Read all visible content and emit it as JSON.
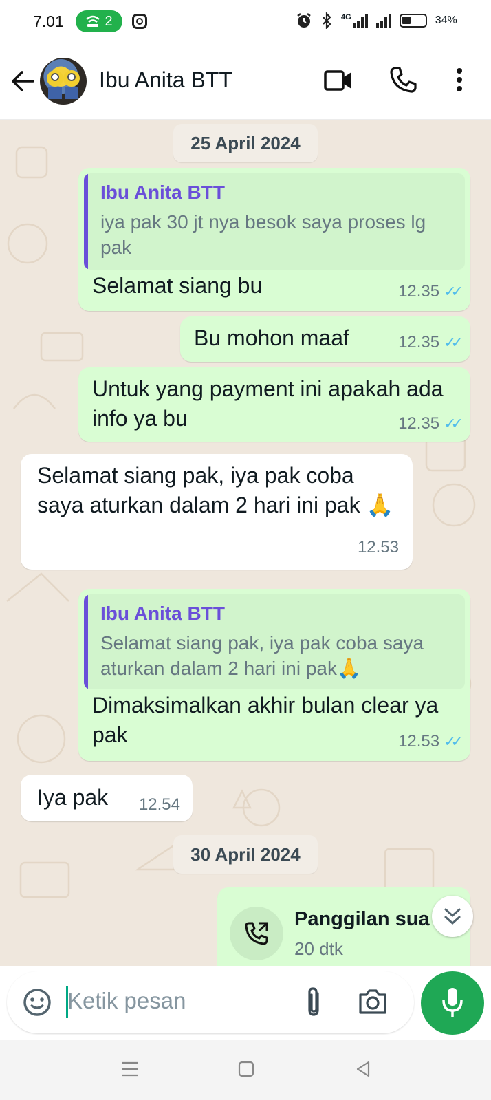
{
  "status_bar": {
    "time": "7.01",
    "hotspot_count": "2",
    "battery": "34%",
    "network": "4G"
  },
  "header": {
    "contact_name": "Ibu Anita BTT",
    "icons": [
      "back-arrow-icon",
      "video-call-icon",
      "voice-call-icon",
      "more-options-icon"
    ]
  },
  "chat": {
    "date_1": "25 April 2024",
    "date_2": "30 April 2024",
    "messages": [
      {
        "direction": "out",
        "quoted_name": "Ibu Anita BTT",
        "quoted_text": "iya pak 30 jt nya besok saya proses lg pak",
        "text": "Selamat siang bu",
        "time": "12.35"
      },
      {
        "direction": "out",
        "text": "Bu mohon maaf",
        "time": "12.35"
      },
      {
        "direction": "out",
        "text": "Untuk yang payment ini apakah ada info ya bu",
        "time": "12.35"
      },
      {
        "direction": "in",
        "text": "Selamat siang pak, iya pak coba saya aturkan dalam 2 hari ini pak 🙏",
        "time": "12.53"
      },
      {
        "direction": "out",
        "quoted_name": "Ibu Anita BTT",
        "quoted_text": "Selamat siang pak, iya pak coba saya aturkan dalam 2 hari ini pak🙏",
        "text": "Dimaksimalkan akhir bulan clear ya pak",
        "time": "12.53"
      },
      {
        "direction": "in",
        "text": "Iya pak",
        "time": "12.54"
      }
    ],
    "call": {
      "title": "Panggilan sua",
      "subtitle": "20 dtk"
    }
  },
  "input": {
    "placeholder": "Ketik pesan"
  },
  "colors": {
    "chat_bg": "#efe7dd",
    "outgoing_bubble": "#d9fdd3",
    "incoming_bubble": "#ffffff",
    "accent_green": "#1fa855",
    "read_ticks": "#53bdeb",
    "quote_accent": "#6a4fd9"
  }
}
